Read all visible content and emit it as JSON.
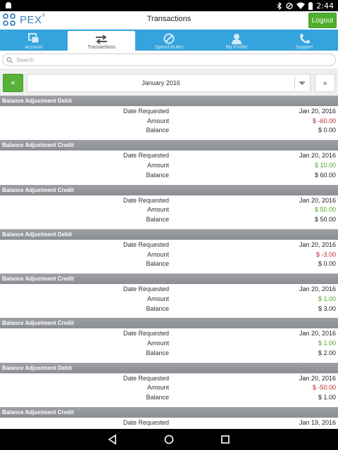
{
  "status_bar": {
    "time": "2:44"
  },
  "header": {
    "logo_text": "PEX",
    "title": "Transactions",
    "logout_label": "Logout"
  },
  "nav": {
    "tabs": [
      {
        "label": "Account",
        "icon": "account-icon"
      },
      {
        "label": "Transactions",
        "icon": "transfer-arrows-icon",
        "active": true
      },
      {
        "label": "Spend Rules",
        "icon": "no-symbol-icon"
      },
      {
        "label": "My Profile",
        "icon": "person-icon"
      },
      {
        "label": "Support",
        "icon": "phone-icon"
      }
    ]
  },
  "search": {
    "placeholder": "Search"
  },
  "month_bar": {
    "prev_label": "«",
    "month": "January 2016",
    "next_label": "»"
  },
  "labels": {
    "date": "Date Requested",
    "amount": "Amount",
    "balance": "Balance"
  },
  "transactions": [
    {
      "type": "Balance Adjustment Debit",
      "date": "Jan 20, 2016",
      "amount": "$ -60.00",
      "balance": "$ 0.00",
      "kind": "debit"
    },
    {
      "type": "Balance Adjustment Credit",
      "date": "Jan 20, 2016",
      "amount": "$ 10.00",
      "balance": "$ 60.00",
      "kind": "credit"
    },
    {
      "type": "Balance Adjustment Credit",
      "date": "Jan 20, 2016",
      "amount": "$ 50.00",
      "balance": "$ 50.00",
      "kind": "credit"
    },
    {
      "type": "Balance Adjustment Debit",
      "date": "Jan 20, 2016",
      "amount": "$ -3.00",
      "balance": "$ 0.00",
      "kind": "debit"
    },
    {
      "type": "Balance Adjustment Credit",
      "date": "Jan 20, 2016",
      "amount": "$ 1.00",
      "balance": "$ 3.00",
      "kind": "credit"
    },
    {
      "type": "Balance Adjustment Credit",
      "date": "Jan 20, 2016",
      "amount": "$ 1.00",
      "balance": "$ 2.00",
      "kind": "credit"
    },
    {
      "type": "Balance Adjustment Debit",
      "date": "Jan 20, 2016",
      "amount": "$ -50.00",
      "balance": "$ 1.00",
      "kind": "debit"
    },
    {
      "type": "Balance Adjustment Credit",
      "date": "Jan 19, 2016",
      "amount": "",
      "balance": "",
      "kind": "credit"
    }
  ],
  "colors": {
    "brand_blue": "#35a3dd",
    "green": "#58b23a",
    "debit": "#c0262c",
    "credit": "#53a52b"
  }
}
